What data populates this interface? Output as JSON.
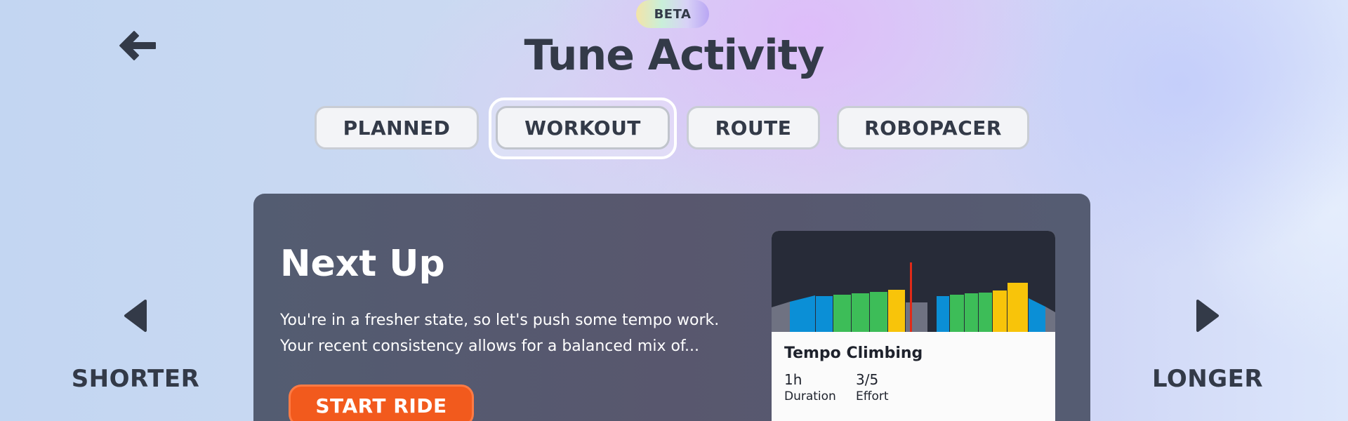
{
  "header": {
    "back_icon": "arrow-left-icon",
    "beta_label": "BETA",
    "title": "Tune Activity"
  },
  "tabs": [
    {
      "label": "PLANNED",
      "active": false
    },
    {
      "label": "WORKOUT",
      "active": true
    },
    {
      "label": "ROUTE",
      "active": false
    },
    {
      "label": "ROBOPACER",
      "active": false
    }
  ],
  "controls": {
    "shorter_label": "SHORTER",
    "shorter_icon": "triangle-left-icon",
    "longer_label": "LONGER",
    "longer_icon": "triangle-right-icon"
  },
  "next_up": {
    "title": "Next Up",
    "description_line1": "You're in a fresher state, so let's push some tempo work.",
    "description_line2": "Your recent consistency allows for a balanced mix of...",
    "start_button": "START RIDE",
    "workout": {
      "name": "Tempo Climbing",
      "duration_value": "1h",
      "duration_label": "Duration",
      "effort_value": "3/5",
      "effort_label": "Effort"
    }
  },
  "colors": {
    "text_dark": "#333a48",
    "card_bg": "#555c72",
    "start_button": "#f25a1d",
    "zone_gray": "#6f7282",
    "zone_blue": "#0b8fd6",
    "zone_green": "#3dbd58",
    "zone_yellow": "#f8c40a",
    "marker_red": "#e02a18"
  }
}
